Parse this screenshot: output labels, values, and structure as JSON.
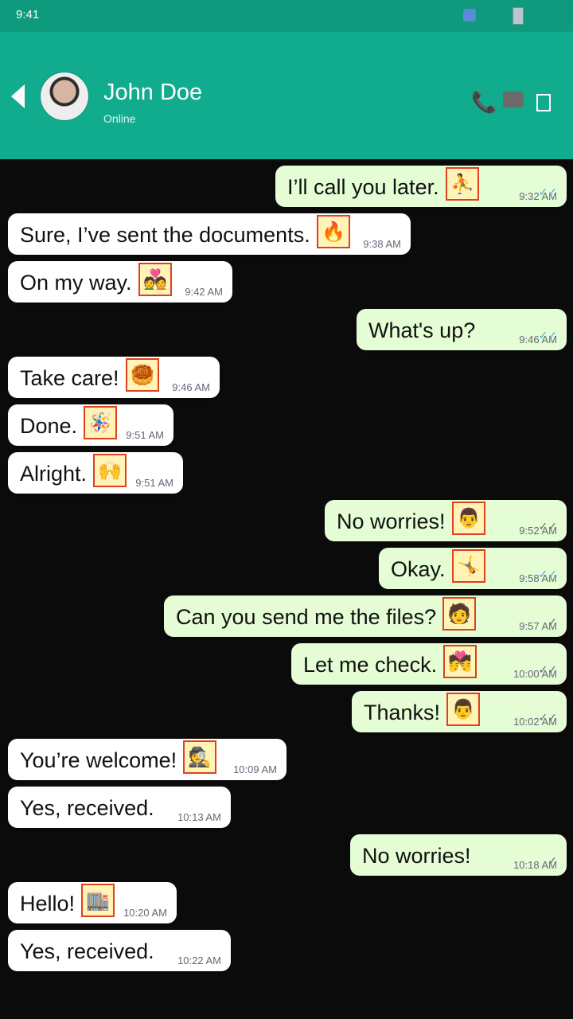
{
  "statusbar": {
    "time": "9:41"
  },
  "header": {
    "name": "John Doe",
    "status": "Online"
  },
  "messages": [
    {
      "dir": "out",
      "text": "I’ll call you later.",
      "emoji": "⛹",
      "time": "9:32 AM",
      "ticks": "✓✓",
      "read": true
    },
    {
      "dir": "in",
      "text": "Sure, I’ve sent the documents.",
      "emoji": "🔥",
      "time": "9:38 AM"
    },
    {
      "dir": "in",
      "text": "On my way.",
      "emoji": "💑",
      "time": "9:42 AM"
    },
    {
      "dir": "out",
      "text": "What's up?",
      "emoji": "",
      "time": "9:46 AM",
      "ticks": "✓✓",
      "read": true
    },
    {
      "dir": "in",
      "text": "Take care!",
      "emoji": "🥮",
      "time": "9:46 AM"
    },
    {
      "dir": "in",
      "text": "Done.",
      "emoji": "🪅",
      "time": "9:51 AM"
    },
    {
      "dir": "in",
      "text": "Alright.",
      "emoji": "🙌",
      "time": "9:51 AM"
    },
    {
      "dir": "out",
      "text": "No worries!",
      "emoji": "👨",
      "time": "9:52 AM",
      "ticks": "✓✓",
      "read": false
    },
    {
      "dir": "out",
      "text": "Okay.",
      "emoji": "🤸",
      "time": "9:58 AM",
      "ticks": "✓✓",
      "read": true
    },
    {
      "dir": "out",
      "text": "Can you send me the files?",
      "emoji": "🧑",
      "time": "9:57 AM",
      "ticks": "✓",
      "read": false
    },
    {
      "dir": "out",
      "text": "Let me check.",
      "emoji": "💏",
      "time": "10:00 AM",
      "ticks": "✓✓",
      "read": false
    },
    {
      "dir": "out",
      "text": "Thanks!",
      "emoji": "👨",
      "time": "10:02 AM",
      "ticks": "✓✓",
      "read": false
    },
    {
      "dir": "in",
      "text": "You’re welcome!",
      "emoji": "🕵",
      "time": "10:09 AM"
    },
    {
      "dir": "in",
      "text": "Yes, received.",
      "emoji": "",
      "time": "10:13 AM"
    },
    {
      "dir": "out",
      "text": "No worries!",
      "emoji": "",
      "time": "10:18 AM",
      "ticks": "✓",
      "read": false
    },
    {
      "dir": "in",
      "text": "Hello!",
      "emoji": "🏬",
      "time": "10:20 AM"
    },
    {
      "dir": "in",
      "text": "Yes, received.",
      "emoji": "",
      "time": "10:22 AM"
    }
  ]
}
